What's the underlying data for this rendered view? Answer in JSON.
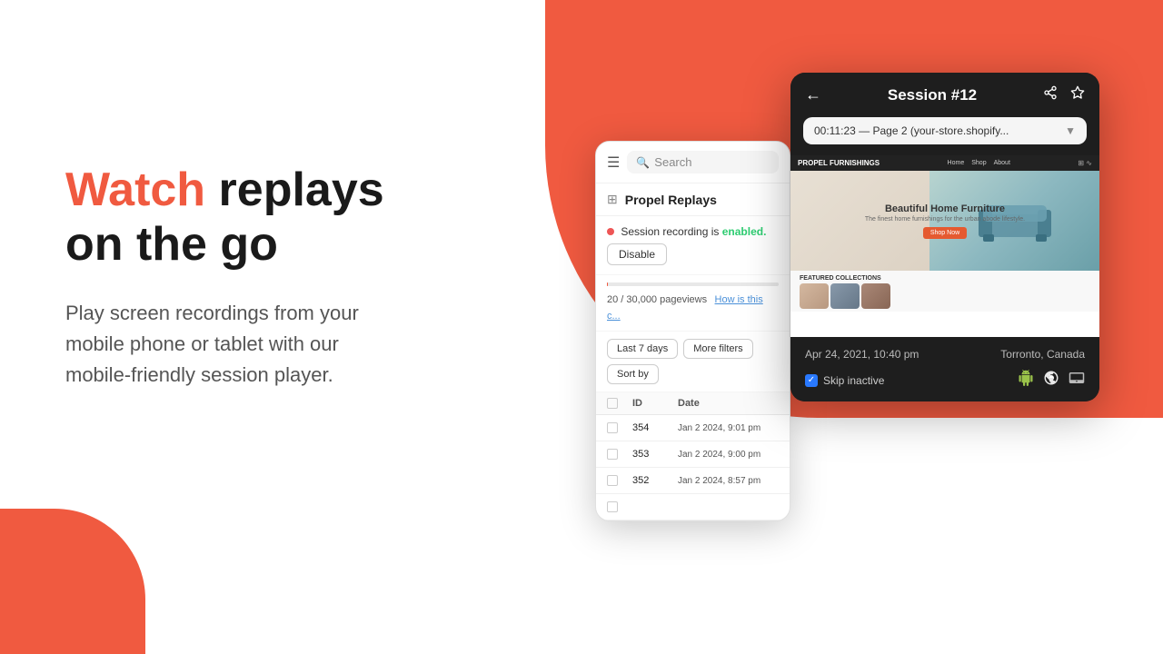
{
  "background": {
    "coral_color": "#F05A40"
  },
  "left": {
    "headline_watch": "Watch",
    "headline_rest": "replays\non the go",
    "subtext": "Play screen recordings from your\nmobile phone or tablet with our\nmobile-friendly session player."
  },
  "phone_left": {
    "search_placeholder": "Search",
    "app_name": "Propel Replays",
    "recording_label": "Session recording is",
    "recording_status": "enabled.",
    "disable_btn": "Disable",
    "pageviews": "20 / 30,000 pageviews",
    "pageviews_link": "How is this c...",
    "filter_last7": "Last 7 days",
    "filter_more": "More filters",
    "sort_by": "Sort by",
    "table": {
      "col_id": "ID",
      "col_date": "Date",
      "rows": [
        {
          "id": "354",
          "date": "Jan 2 2024, 9:01 pm"
        },
        {
          "id": "353",
          "date": "Jan 2 2024, 9:00 pm"
        },
        {
          "id": "352",
          "date": "Jan 2 2024, 8:57 pm"
        }
      ]
    }
  },
  "session_player": {
    "title": "Session #12",
    "url": "00:11:23 — Page 2 (your-store.shopify...",
    "website_brand": "PROPEL FURNISHINGS",
    "website_hero_title": "Beautiful Home Furniture",
    "website_hero_sub": "The finest home furnishings for the urban abode lifestyle.",
    "website_hero_btn": "Shop Now",
    "products_label": "FEATURED COLLECTIONS",
    "date": "Apr 24, 2021, 10:40 pm",
    "location": "Torronto, Canada",
    "skip_inactive": "Skip inactive",
    "devices": [
      "android",
      "chrome",
      "tablet"
    ]
  }
}
